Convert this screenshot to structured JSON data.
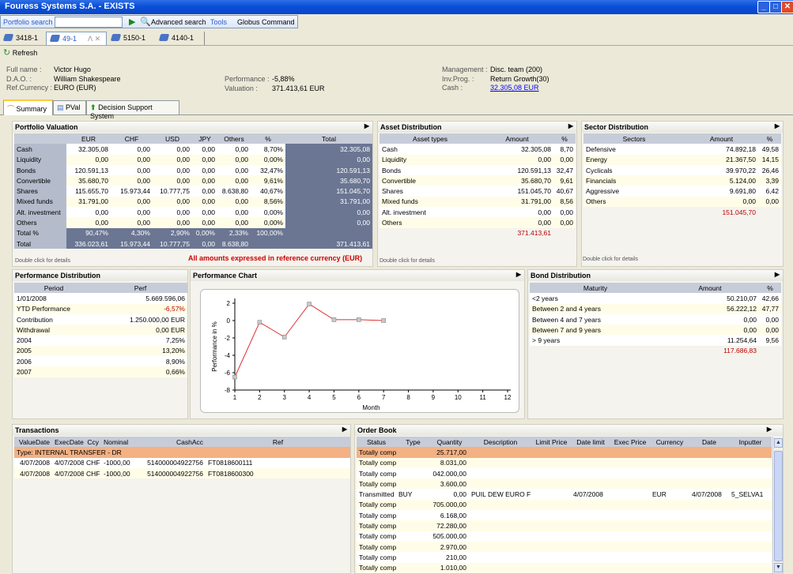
{
  "window": {
    "title": "Fouress Systems S.A. - EXISTS"
  },
  "toolbar": {
    "portfolio_search": "Portfolio search",
    "advanced_search": "Advanced search",
    "tools": "Tools",
    "globus_command": "Globus Command",
    "search_value": ""
  },
  "doc_tabs": [
    "3418-1",
    "49-1",
    "5150-1",
    "4140-1"
  ],
  "refresh": "Refresh",
  "client": {
    "full_name_label": "Full name :",
    "full_name": "Victor Hugo",
    "dao_label": "D.A.O. :",
    "dao": "William Shakespeare",
    "ref_ccy_label": "Ref.Currency :",
    "ref_ccy": "EURO (EUR)",
    "perf_label": "Performance :",
    "perf": "-5,88%",
    "valuation_label": "Valuation :",
    "valuation": "371.413,61 EUR",
    "mgmt_label": "Management :",
    "mgmt": "Disc. team (200)",
    "invprog_label": "Inv.Prog. :",
    "invprog": "Return Growth(30)",
    "cash_label": "Cash :",
    "cash": "32.305,08 EUR"
  },
  "inner_tabs": [
    "Summary",
    "PVal",
    "Decision Support System"
  ],
  "portfolio_valuation": {
    "title": "Portfolio Valuation",
    "headers": [
      "",
      "EUR",
      "CHF",
      "USD",
      "JPY",
      "Others",
      "%",
      "Total"
    ],
    "rows": [
      [
        "Cash",
        "32.305,08",
        "0,00",
        "0,00",
        "0,00",
        "0,00",
        "8,70%",
        "32.305,08"
      ],
      [
        "Liquidity",
        "0,00",
        "0,00",
        "0,00",
        "0,00",
        "0,00",
        "0,00%",
        "0,00"
      ],
      [
        "Bonds",
        "120.591,13",
        "0,00",
        "0,00",
        "0,00",
        "0,00",
        "32,47%",
        "120.591,13"
      ],
      [
        "Convertible",
        "35.680,70",
        "0,00",
        "0,00",
        "0,00",
        "0,00",
        "9,61%",
        "35.680,70"
      ],
      [
        "Shares",
        "115.655,70",
        "15.973,44",
        "10.777,75",
        "0,00",
        "8.638,80",
        "40,67%",
        "151.045,70"
      ],
      [
        "Mixed funds",
        "31.791,00",
        "0,00",
        "0,00",
        "0,00",
        "0,00",
        "8,56%",
        "31.791,00"
      ],
      [
        "Alt. investment",
        "0,00",
        "0,00",
        "0,00",
        "0,00",
        "0,00",
        "0,00%",
        "0,00"
      ],
      [
        "Others",
        "0,00",
        "0,00",
        "0,00",
        "0,00",
        "0,00",
        "0,00%",
        "0,00"
      ]
    ],
    "total_pct": [
      "Total %",
      "90,47%",
      "4,30%",
      "2,90%",
      "0,00%",
      "2,33%",
      "100,00%",
      ""
    ],
    "total": [
      "Total",
      "336.023,61",
      "15.973,44",
      "10.777,75",
      "0,00",
      "8.638,80",
      "",
      "371.413,61"
    ],
    "dbl": "Double click for details",
    "note": "All amounts expressed in reference currency (EUR)"
  },
  "asset_distribution": {
    "title": "Asset Distribution",
    "headers": [
      "Asset types",
      "Amount",
      "%"
    ],
    "rows": [
      [
        "Cash",
        "32.305,08",
        "8,70"
      ],
      [
        "Liquidity",
        "0,00",
        "0,00"
      ],
      [
        "Bonds",
        "120.591,13",
        "32,47"
      ],
      [
        "Convertible",
        "35.680,70",
        "9,61"
      ],
      [
        "Shares",
        "151.045,70",
        "40,67"
      ],
      [
        "Mixed funds",
        "31.791,00",
        "8,56"
      ],
      [
        "Alt. investment",
        "0,00",
        "0,00"
      ],
      [
        "Others",
        "0,00",
        "0,00"
      ]
    ],
    "total": "371.413,61",
    "dbl": "Double click for details"
  },
  "sector_distribution": {
    "title": "Sector Distribution",
    "headers": [
      "Sectors",
      "Amount",
      "%"
    ],
    "rows": [
      [
        "Defensive",
        "74.892,18",
        "49,58"
      ],
      [
        "Energy",
        "21.367,50",
        "14,15"
      ],
      [
        "Cyclicals",
        "39.970,22",
        "26,46"
      ],
      [
        "Financials",
        "5.124,00",
        "3,39"
      ],
      [
        "Aggressive",
        "9.691,80",
        "6,42"
      ],
      [
        "Others",
        "0,00",
        "0,00"
      ]
    ],
    "total": "151.045,70",
    "dbl": "Double click for details"
  },
  "performance_distribution": {
    "title": "Performance Distribution",
    "headers": [
      "Period",
      "Perf"
    ],
    "rows": [
      [
        "1/01/2008",
        "5.669.596,06"
      ],
      [
        "YTD Performance",
        "-6,57%"
      ],
      [
        "Contribution",
        "1.250.000,00 EUR"
      ],
      [
        "Withdrawal",
        "0,00 EUR"
      ],
      [
        "2004",
        "7,25%"
      ],
      [
        "2005",
        "13,20%"
      ],
      [
        "2006",
        "8,90%"
      ],
      [
        "2007",
        "0,66%"
      ]
    ]
  },
  "performance_chart": {
    "title": "Performance Chart"
  },
  "chart_data": {
    "type": "line",
    "x": [
      1,
      2,
      3,
      4,
      5,
      6,
      7
    ],
    "series": [
      {
        "values": [
          -6.5,
          -0.2,
          -1.9,
          1.9,
          0.1,
          0.1,
          0.0
        ]
      }
    ],
    "xlabel": "Month",
    "ylabel": "Performance in %",
    "xlim": [
      1,
      12
    ],
    "ylim": [
      -8,
      2
    ],
    "xticks": [
      "1",
      "2",
      "3",
      "4",
      "5",
      "6",
      "7",
      "8",
      "9",
      "10",
      "11",
      "12"
    ],
    "yticks": [
      "2",
      "0",
      "-2",
      "-4",
      "-6",
      "-8"
    ],
    "color": "#e03030"
  },
  "bond_distribution": {
    "title": "Bond Distribution",
    "headers": [
      "Maturity",
      "Amount",
      "%"
    ],
    "rows": [
      [
        "<2 years",
        "50.210,07",
        "42,66"
      ],
      [
        "Between 2 and 4 years",
        "56.222,12",
        "47,77"
      ],
      [
        "Between 4 and 7 years",
        "0,00",
        "0,00"
      ],
      [
        "Between 7 and 9 years",
        "0,00",
        "0,00"
      ],
      [
        "> 9 years",
        "11.254,64",
        "9,56"
      ]
    ],
    "total": "117.686,83"
  },
  "transactions": {
    "title": "Transactions",
    "headers": [
      "ValueDate",
      "ExecDate",
      "Ccy",
      "Nominal",
      "CashAcc",
      "Ref"
    ],
    "group": "Type: INTERNAL TRANSFER - DR",
    "rows": [
      [
        "4/07/2008",
        "4/07/2008",
        "CHF",
        "-1000,00",
        "514000004922756",
        "FT0818600111"
      ],
      [
        "4/07/2008",
        "4/07/2008",
        "CHF",
        "-1000,00",
        "514000004922756",
        "FT0818600300"
      ]
    ]
  },
  "order_book": {
    "title": "Order Book",
    "headers": [
      "Status",
      "Type",
      "Quantity",
      "Description",
      "Limit Price",
      "Date limit",
      "Exec Price",
      "Currency",
      "Date",
      "Inputter"
    ],
    "rows": [
      [
        "Totally comp",
        "",
        "25.717,00",
        "",
        "",
        "",
        "",
        "",
        "",
        ""
      ],
      [
        "Totally comp",
        "",
        "8.031,00",
        "",
        "",
        "",
        "",
        "",
        "",
        ""
      ],
      [
        "Totally comp",
        "",
        "042.000,00",
        "",
        "",
        "",
        "",
        "",
        "",
        ""
      ],
      [
        "Totally comp",
        "",
        "3.600,00",
        "",
        "",
        "",
        "",
        "",
        "",
        ""
      ],
      [
        "Transmitted",
        "BUY",
        "0,00",
        "PUIL DEW EURO F",
        "",
        "4/07/2008",
        "",
        "EUR",
        "4/07/2008",
        "5_SELVA1"
      ],
      [
        "Totally comp",
        "",
        "705.000,00",
        "",
        "",
        "",
        "",
        "",
        "",
        ""
      ],
      [
        "Totally comp",
        "",
        "6.168,00",
        "",
        "",
        "",
        "",
        "",
        "",
        ""
      ],
      [
        "Totally comp",
        "",
        "72.280,00",
        "",
        "",
        "",
        "",
        "",
        "",
        ""
      ],
      [
        "Totally comp",
        "",
        "505.000,00",
        "",
        "",
        "",
        "",
        "",
        "",
        ""
      ],
      [
        "Totally comp",
        "",
        "2.970,00",
        "",
        "",
        "",
        "",
        "",
        "",
        ""
      ],
      [
        "Totally comp",
        "",
        "210,00",
        "",
        "",
        "",
        "",
        "",
        "",
        ""
      ],
      [
        "Totally comp",
        "",
        "1.010,00",
        "",
        "",
        "",
        "",
        "",
        "",
        ""
      ]
    ]
  }
}
